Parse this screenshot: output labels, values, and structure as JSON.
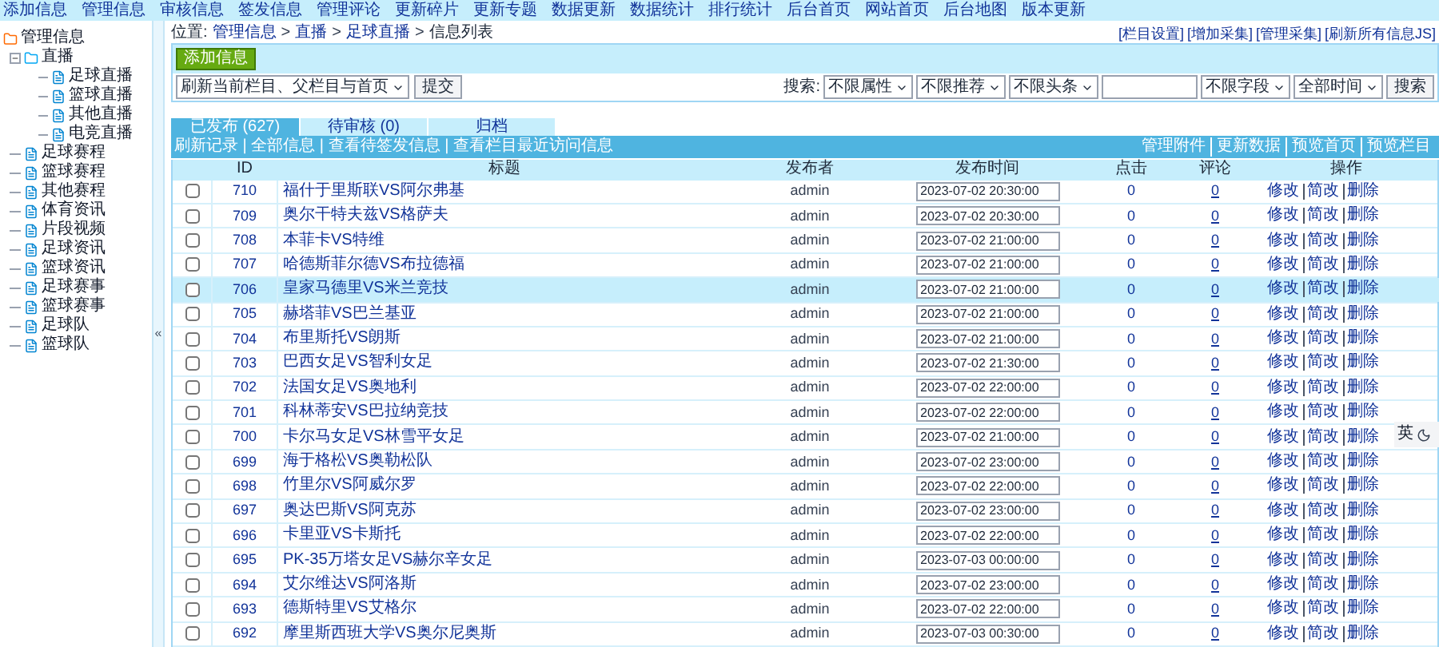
{
  "top_menu": [
    "添加信息",
    "管理信息",
    "审核信息",
    "签发信息",
    "管理评论",
    "更新碎片",
    "更新专题",
    "数据更新",
    "数据统计",
    "排行统计",
    "后台首页",
    "网站首页",
    "后台地图",
    "版本更新"
  ],
  "sidebar": {
    "title": "管理信息",
    "items": [
      {
        "label": "直播",
        "expanded": true,
        "children": [
          {
            "label": "足球直播"
          },
          {
            "label": "篮球直播"
          },
          {
            "label": "其他直播"
          },
          {
            "label": "电竞直播"
          }
        ]
      },
      {
        "label": "足球赛程"
      },
      {
        "label": "篮球赛程"
      },
      {
        "label": "其他赛程"
      },
      {
        "label": "体育资讯"
      },
      {
        "label": "片段视频"
      },
      {
        "label": "足球资讯"
      },
      {
        "label": "篮球资讯"
      },
      {
        "label": "足球赛事"
      },
      {
        "label": "篮球赛事"
      },
      {
        "label": "足球队"
      },
      {
        "label": "篮球队"
      }
    ]
  },
  "collapse_handle": "«",
  "breadcrumb": [
    {
      "kind": "label",
      "text": "位置:"
    },
    {
      "kind": "link",
      "text": "管理信息"
    },
    {
      "kind": "separator",
      "text": ">"
    },
    {
      "kind": "link",
      "text": "直播"
    },
    {
      "kind": "separator",
      "text": ">"
    },
    {
      "kind": "link",
      "text": "足球直播"
    },
    {
      "kind": "separator",
      "text": ">"
    },
    {
      "kind": "current",
      "text": "信息列表"
    }
  ],
  "top_links": [
    "[栏目设置]",
    "[增加采集]",
    "[管理采集]",
    "[刷新所有信息JS]"
  ],
  "add_button": "添加信息",
  "refresh": {
    "select": "刷新当前栏目、父栏目与首页",
    "button": "提交"
  },
  "search": {
    "label": "搜索:",
    "filters_before": [
      "不限属性",
      "不限推荐",
      "不限头条"
    ],
    "filters_after": [
      "不限字段",
      "全部时间"
    ],
    "button": "搜索"
  },
  "tabs": [
    {
      "label": "已发布 (627)",
      "selected": true
    },
    {
      "label": "待审核 (0)",
      "selected": false
    },
    {
      "label": "归档",
      "selected": false
    }
  ],
  "bar_left": "刷新记录 | 全部信息 | 查看待签发信息 | 查看栏目最近访问信息",
  "bar_right": [
    "管理附件",
    "更新数据",
    "预览首页",
    "预览栏目"
  ],
  "table": {
    "columns": [
      "ID",
      "标题",
      "发布者",
      "发布时间",
      "点击",
      "评论",
      "操作"
    ],
    "rows": [
      {
        "id": "710",
        "title": "福什于里斯联VS阿尔弗基",
        "author": "admin",
        "time": "2023-07-02 20:30:00",
        "clicks": "0",
        "comments": "0",
        "actions": [
          "修改",
          "简改",
          "删除"
        ],
        "checked": false,
        "selected": false
      },
      {
        "id": "709",
        "title": "奥尔干特夫兹VS格萨夫",
        "author": "admin",
        "time": "2023-07-02 20:30:00",
        "clicks": "0",
        "comments": "0",
        "actions": [
          "修改",
          "简改",
          "删除"
        ],
        "checked": false,
        "selected": false
      },
      {
        "id": "708",
        "title": "本菲卡VS特维",
        "author": "admin",
        "time": "2023-07-02 21:00:00",
        "clicks": "0",
        "comments": "0",
        "actions": [
          "修改",
          "简改",
          "删除"
        ],
        "checked": false,
        "selected": false
      },
      {
        "id": "707",
        "title": "哈德斯菲尔德VS布拉德福",
        "author": "admin",
        "time": "2023-07-02 21:00:00",
        "clicks": "0",
        "comments": "0",
        "actions": [
          "修改",
          "简改",
          "删除"
        ],
        "checked": false,
        "selected": false
      },
      {
        "id": "706",
        "title": "皇家马德里VS米兰竞技",
        "author": "admin",
        "time": "2023-07-02 21:00:00",
        "clicks": "0",
        "comments": "0",
        "actions": [
          "修改",
          "简改",
          "删除"
        ],
        "checked": false,
        "selected": true
      },
      {
        "id": "705",
        "title": "赫塔菲VS巴兰基亚",
        "author": "admin",
        "time": "2023-07-02 21:00:00",
        "clicks": "0",
        "comments": "0",
        "actions": [
          "修改",
          "简改",
          "删除"
        ],
        "checked": false,
        "selected": false
      },
      {
        "id": "704",
        "title": "布里斯托VS朗斯",
        "author": "admin",
        "time": "2023-07-02 21:00:00",
        "clicks": "0",
        "comments": "0",
        "actions": [
          "修改",
          "简改",
          "删除"
        ],
        "checked": false,
        "selected": false
      },
      {
        "id": "703",
        "title": "巴西女足VS智利女足",
        "author": "admin",
        "time": "2023-07-02 21:30:00",
        "clicks": "0",
        "comments": "0",
        "actions": [
          "修改",
          "简改",
          "删除"
        ],
        "checked": false,
        "selected": false
      },
      {
        "id": "702",
        "title": "法国女足VS奥地利",
        "author": "admin",
        "time": "2023-07-02 22:00:00",
        "clicks": "0",
        "comments": "0",
        "actions": [
          "修改",
          "简改",
          "删除"
        ],
        "checked": false,
        "selected": false
      },
      {
        "id": "701",
        "title": "科林蒂安VS巴拉纳竞技",
        "author": "admin",
        "time": "2023-07-02 22:00:00",
        "clicks": "0",
        "comments": "0",
        "actions": [
          "修改",
          "简改",
          "删除"
        ],
        "checked": false,
        "selected": false
      },
      {
        "id": "700",
        "title": "卡尔马女足VS林雪平女足",
        "author": "admin",
        "time": "2023-07-02 21:00:00",
        "clicks": "0",
        "comments": "0",
        "actions": [
          "修改",
          "简改",
          "删除"
        ],
        "checked": false,
        "selected": false
      },
      {
        "id": "699",
        "title": "海于格松VS奥勒松队",
        "author": "admin",
        "time": "2023-07-02 23:00:00",
        "clicks": "0",
        "comments": "0",
        "actions": [
          "修改",
          "简改",
          "删除"
        ],
        "checked": false,
        "selected": false
      },
      {
        "id": "698",
        "title": "竹里尔VS阿威尔罗",
        "author": "admin",
        "time": "2023-07-02 22:00:00",
        "clicks": "0",
        "comments": "0",
        "actions": [
          "修改",
          "简改",
          "删除"
        ],
        "checked": false,
        "selected": false
      },
      {
        "id": "697",
        "title": "奥达巴斯VS阿克苏",
        "author": "admin",
        "time": "2023-07-02 23:00:00",
        "clicks": "0",
        "comments": "0",
        "actions": [
          "修改",
          "简改",
          "删除"
        ],
        "checked": false,
        "selected": false
      },
      {
        "id": "696",
        "title": "卡里亚VS卡斯托",
        "author": "admin",
        "time": "2023-07-02 22:00:00",
        "clicks": "0",
        "comments": "0",
        "actions": [
          "修改",
          "简改",
          "删除"
        ],
        "checked": false,
        "selected": false
      },
      {
        "id": "695",
        "title": "PK-35万塔女足VS赫尔辛女足",
        "author": "admin",
        "time": "2023-07-03 00:00:00",
        "clicks": "0",
        "comments": "0",
        "actions": [
          "修改",
          "简改",
          "删除"
        ],
        "checked": false,
        "selected": false
      },
      {
        "id": "694",
        "title": "艾尔维达VS阿洛斯",
        "author": "admin",
        "time": "2023-07-02 23:00:00",
        "clicks": "0",
        "comments": "0",
        "actions": [
          "修改",
          "简改",
          "删除"
        ],
        "checked": false,
        "selected": false
      },
      {
        "id": "693",
        "title": "德斯特里VS艾格尔",
        "author": "admin",
        "time": "2023-07-02 22:00:00",
        "clicks": "0",
        "comments": "0",
        "actions": [
          "修改",
          "简改",
          "删除"
        ],
        "checked": false,
        "selected": false
      },
      {
        "id": "692",
        "title": "摩里斯西班大学VS奥尔尼奥斯",
        "author": "admin",
        "time": "2023-07-03 00:30:00",
        "clicks": "0",
        "comments": "0",
        "actions": [
          "修改",
          "简改",
          "删除"
        ],
        "checked": false,
        "selected": false
      }
    ]
  },
  "ime_toolbar": {
    "label": "英"
  }
}
